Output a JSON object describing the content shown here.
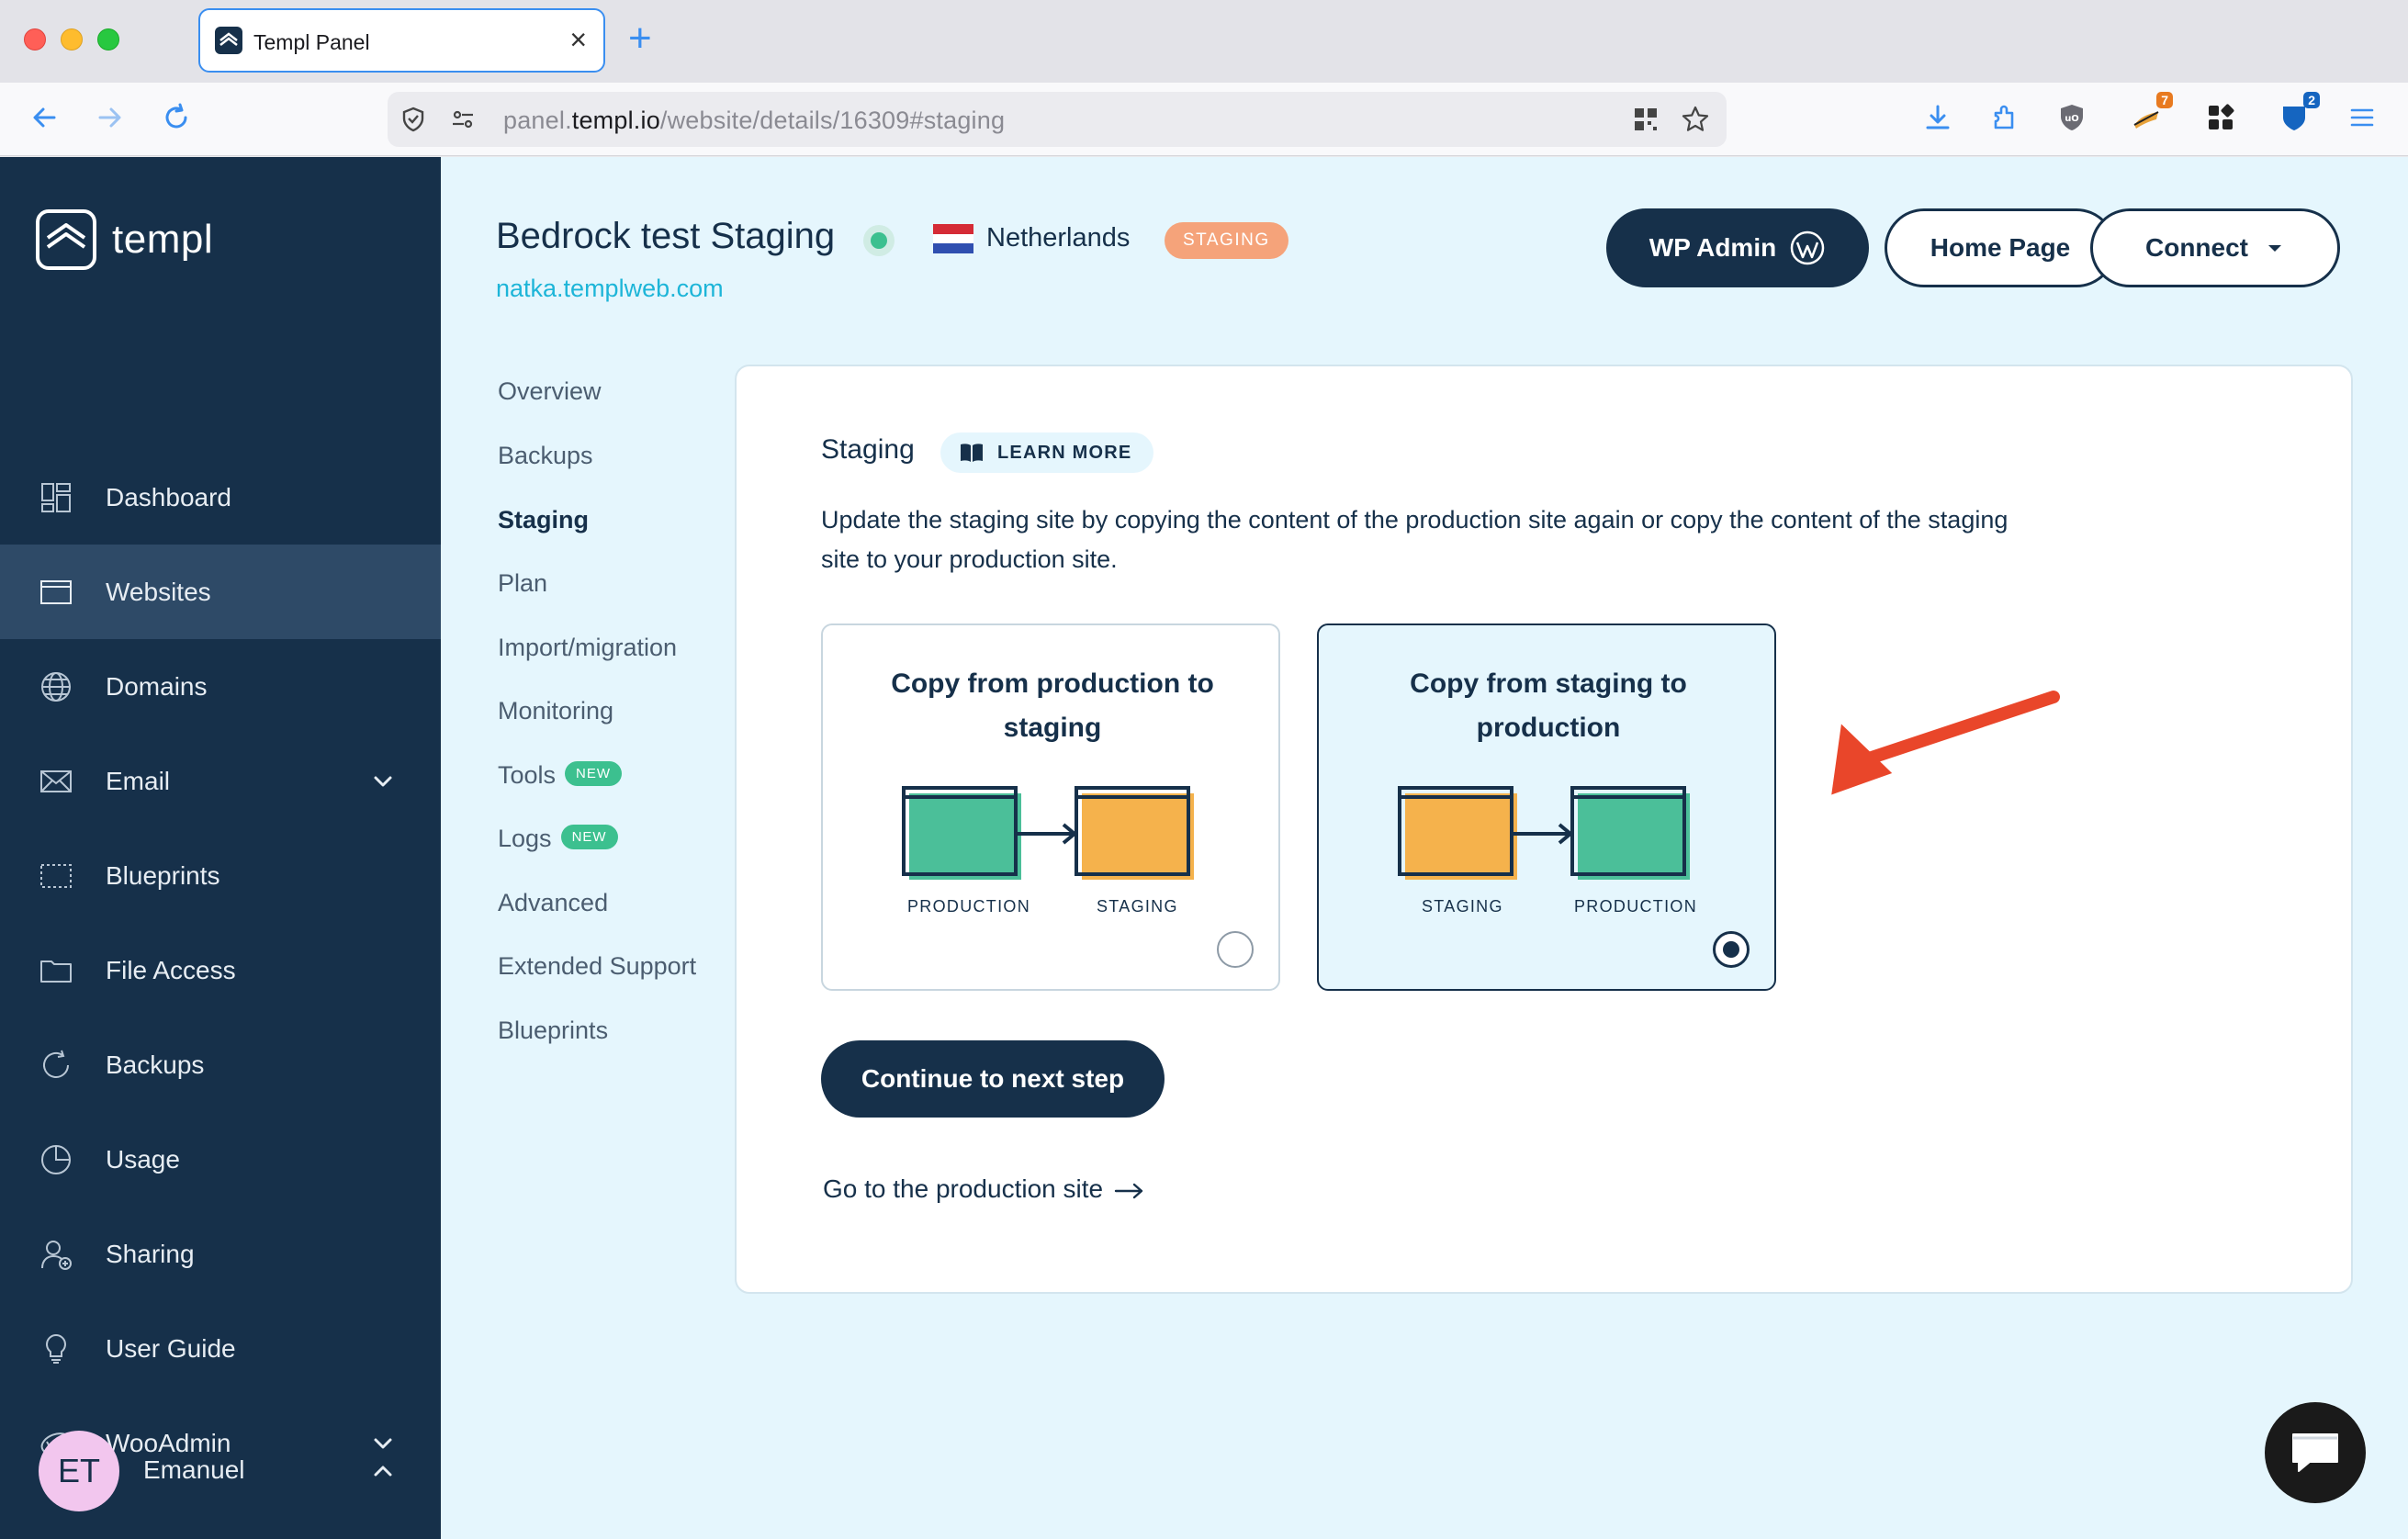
{
  "browser": {
    "tab_title": "Templ Panel",
    "url_prefix": "panel.",
    "url_host": "templ.io",
    "url_path": "/website/details/16309#staging",
    "ext_badge_1": "7",
    "ext_badge_2": "2"
  },
  "sidebar": {
    "logo": "templ",
    "items": [
      {
        "label": "Dashboard",
        "icon": "dashboard-icon"
      },
      {
        "label": "Websites",
        "icon": "browser-window-icon"
      },
      {
        "label": "Domains",
        "icon": "globe-icon"
      },
      {
        "label": "Email",
        "icon": "envelope-icon"
      },
      {
        "label": "Blueprints",
        "icon": "dotted-rect-icon"
      },
      {
        "label": "File Access",
        "icon": "folder-icon"
      },
      {
        "label": "Backups",
        "icon": "refresh-icon"
      },
      {
        "label": "Usage",
        "icon": "pie-chart-icon"
      },
      {
        "label": "Sharing",
        "icon": "user-plus-icon"
      },
      {
        "label": "User Guide",
        "icon": "lightbulb-icon"
      },
      {
        "label": "WooAdmin",
        "icon": "woo-icon"
      }
    ],
    "user_initials": "ET",
    "user_name": "Emanuel"
  },
  "header": {
    "site_title": "Bedrock test Staging",
    "country": "Netherlands",
    "badge": "STAGING",
    "domain": "natka.templweb.com",
    "wp_admin": "WP Admin",
    "home_page": "Home Page",
    "connect": "Connect"
  },
  "subnav": {
    "items": [
      "Overview",
      "Backups",
      "Staging",
      "Plan",
      "Import/migration",
      "Monitoring",
      "Tools",
      "Logs",
      "Advanced",
      "Extended Support",
      "Blueprints"
    ],
    "new_tag": "NEW"
  },
  "card": {
    "title": "Staging",
    "learn_more": "LEARN MORE",
    "description": "Update the staging site by copying the content of the production site again or copy the content of the staging site to your production site.",
    "option1": {
      "title": "Copy from production to staging",
      "from": "PRODUCTION",
      "to": "STAGING",
      "selected": false
    },
    "option2": {
      "title": "Copy from staging to production",
      "from": "STAGING",
      "to": "PRODUCTION",
      "selected": true
    },
    "continue": "Continue to next step",
    "production_link": "Go to the production site"
  },
  "colors": {
    "navy": "#16304a",
    "accent_green": "#3cc08f",
    "diagram_green": "#4bbf99",
    "diagram_orange": "#f5b24c",
    "badge_orange": "#f5a37a",
    "link_blue": "#1db5d8",
    "arrow_red": "#e9462a"
  }
}
